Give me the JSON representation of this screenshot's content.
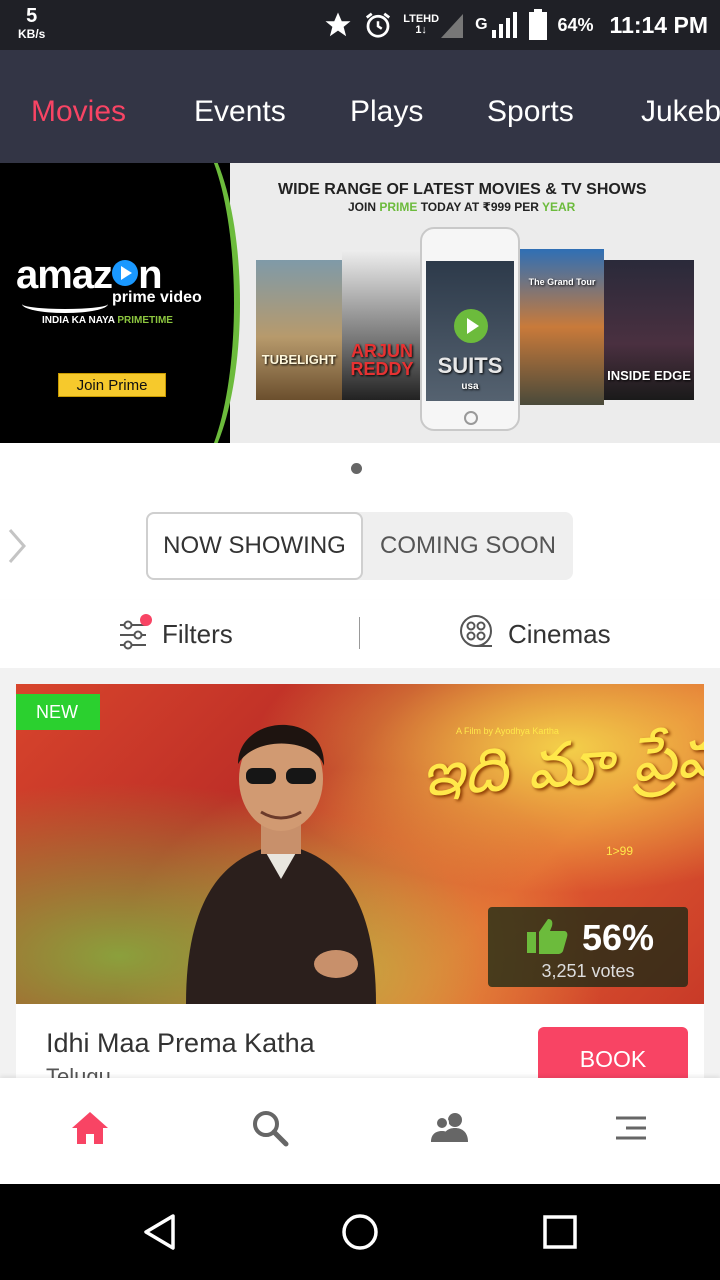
{
  "status_bar": {
    "speed_value": "5",
    "speed_unit": "KB/s",
    "network_lte": "LTE",
    "network_hd": "HD",
    "network_g": "G",
    "battery": "64%",
    "time": "11:14 PM"
  },
  "top_nav": {
    "tabs": [
      {
        "label": "Movies",
        "active": true
      },
      {
        "label": "Events",
        "active": false
      },
      {
        "label": "Plays",
        "active": false
      },
      {
        "label": "Sports",
        "active": false
      },
      {
        "label": "Jukebox",
        "active": false
      }
    ]
  },
  "banner": {
    "brand": "amazon",
    "product": "prime video",
    "tagline_prefix": "INDIA KA NAYA ",
    "tagline_highlight": "PRIMETIME",
    "cta": "Join Prime",
    "headline": "WIDE RANGE OF LATEST MOVIES & TV SHOWS",
    "sub_join": "JOIN ",
    "sub_prime": "PRIME",
    "sub_today": " TODAY AT ",
    "sub_price": "₹999",
    "sub_per": " PER ",
    "sub_year": "YEAR",
    "posters": [
      "TUBELIGHT",
      "ARJUN REDDY",
      "SUITS",
      "The Grand Tour",
      "INSIDE EDGE"
    ],
    "phone_label": "usa"
  },
  "carousel": {
    "current": 1,
    "total": 1
  },
  "segment": {
    "now_showing": "NOW SHOWING",
    "coming_soon": "COMING SOON",
    "selected": "now_showing"
  },
  "filters": {
    "filters_label": "Filters",
    "cinemas_label": "Cinemas"
  },
  "movie": {
    "badge": "NEW",
    "title": "Idhi Maa Prema Katha",
    "language": "Telugu",
    "rating_percent": "56%",
    "votes": "3,251 votes",
    "book_label": "BOOK",
    "poster_title_art": "ఇది మా ప్రేమకథ",
    "poster_credit": "A Film by Ayodhya Kartha",
    "poster_tag": "1>99"
  },
  "bottom_nav": {
    "items": [
      "home-icon",
      "search-icon",
      "people-icon",
      "menu-icon"
    ],
    "active": "home-icon",
    "accent_color": "#f84464",
    "inactive_color": "#666666"
  },
  "system_nav": {
    "items": [
      "back-icon",
      "home-circle-icon",
      "recents-icon"
    ]
  },
  "colors": {
    "accent": "#f84464",
    "nav_bg": "#333545",
    "status_bg": "#1f2026",
    "new_badge": "#2bd02f",
    "prime_green": "#6cbb3c"
  }
}
